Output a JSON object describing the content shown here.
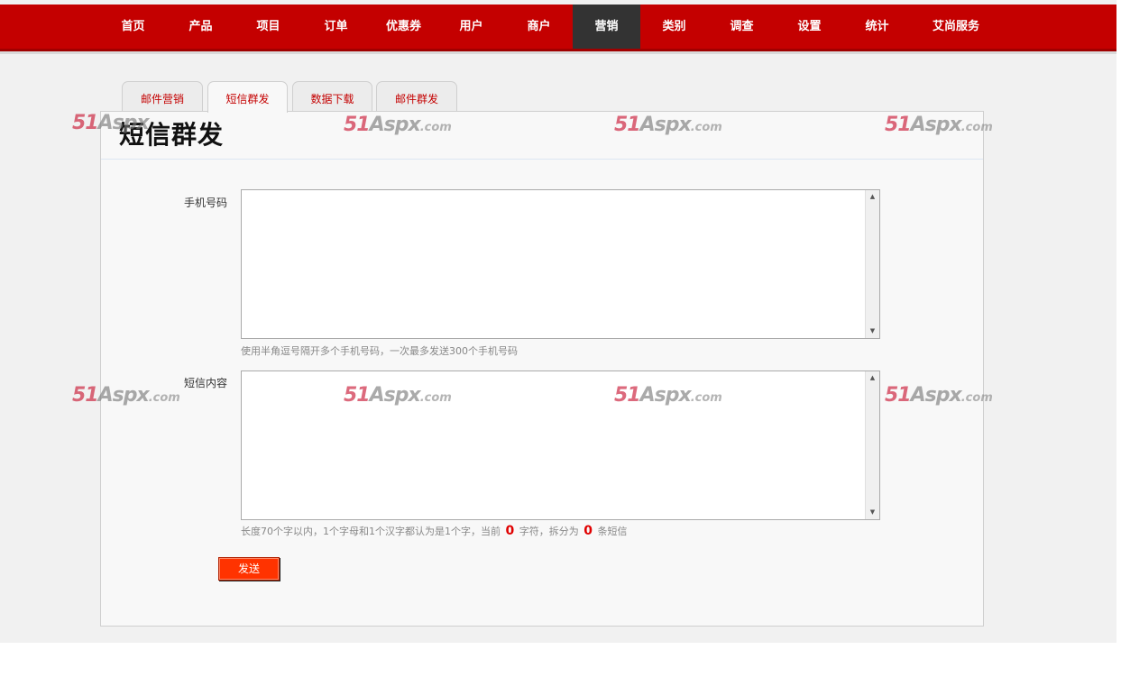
{
  "nav": {
    "items": [
      {
        "label": "首页"
      },
      {
        "label": "产品"
      },
      {
        "label": "项目"
      },
      {
        "label": "订单"
      },
      {
        "label": "优惠券"
      },
      {
        "label": "用户"
      },
      {
        "label": "商户"
      },
      {
        "label": "营销",
        "active": true
      },
      {
        "label": "类别"
      },
      {
        "label": "调查"
      },
      {
        "label": "设置"
      },
      {
        "label": "统计"
      },
      {
        "label": "艾尚服务"
      }
    ],
    "active_color": "#333333",
    "bar_color": "#c40000"
  },
  "tabs": [
    {
      "label": "邮件营销"
    },
    {
      "label": "短信群发",
      "active": true
    },
    {
      "label": "数据下载"
    },
    {
      "label": "邮件群发"
    }
  ],
  "page": {
    "title": "短信群发"
  },
  "form": {
    "phone_label": "手机号码",
    "phone_value": "",
    "phone_hint": "使用半角逗号隔开多个手机号码，一次最多发送300个手机号码",
    "content_label": "短信内容",
    "content_value": "",
    "content_hint_1": "长度70个字以内，1个字母和1个汉字都认为是1个字，当前",
    "char_count": "0",
    "content_hint_2": "字符，拆分为",
    "sms_count": "0",
    "content_hint_3": "条短信",
    "send_label": "发送"
  },
  "watermark": {
    "num": "51",
    "brand": "Aspx",
    "suffix": ".com"
  }
}
